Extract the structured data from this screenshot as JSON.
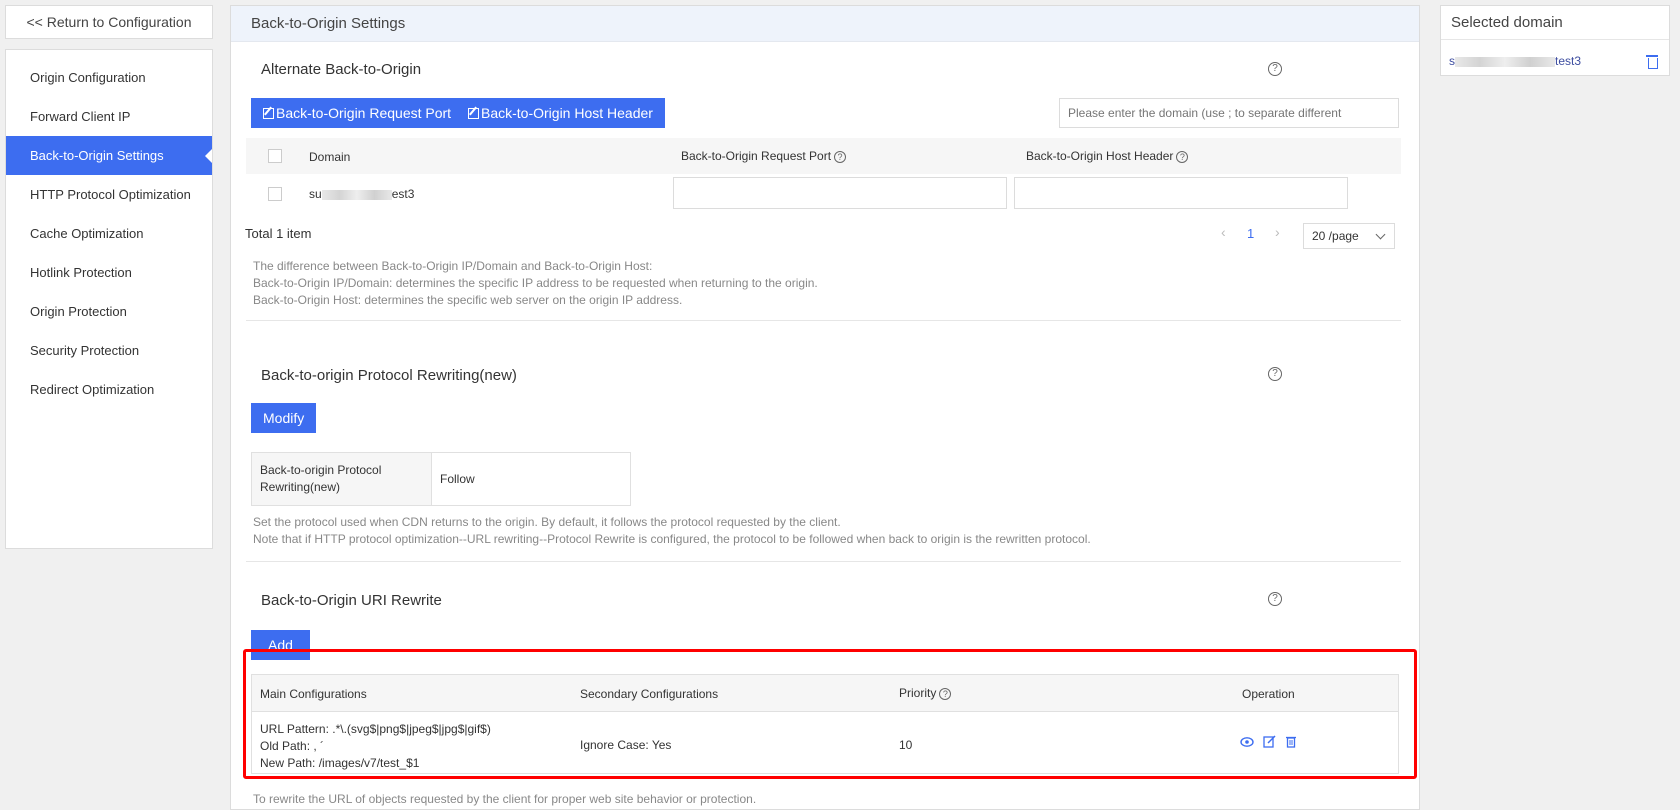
{
  "nav": {
    "back_label": "<< Return to Configuration",
    "items": [
      {
        "label": "Origin Configuration"
      },
      {
        "label": "Forward Client IP"
      },
      {
        "label": "Back-to-Origin Settings"
      },
      {
        "label": "HTTP Protocol Optimization"
      },
      {
        "label": "Cache Optimization"
      },
      {
        "label": "Hotlink Protection"
      },
      {
        "label": "Origin Protection"
      },
      {
        "label": "Security Protection"
      },
      {
        "label": "Redirect Optimization"
      }
    ],
    "active_index": 2
  },
  "header": {
    "title": "Back-to-Origin Settings"
  },
  "alternate": {
    "title": "Alternate Back-to-Origin",
    "port_button": "Back-to-Origin Request Port",
    "host_button": "Back-to-Origin Host Header",
    "search_placeholder": "Please enter the domain (use ; to separate different",
    "columns": [
      "Domain",
      "Back-to-Origin Request Port",
      "Back-to-Origin Host Header"
    ],
    "rows": [
      {
        "domain_prefix": "su",
        "domain_suffix": "est3"
      }
    ],
    "total": "Total 1 item",
    "page": "1",
    "page_size": "20 /page",
    "notes": [
      "The difference between Back-to-Origin IP/Domain and Back-to-Origin Host:",
      "Back-to-Origin IP/Domain: determines the specific IP address to be requested when returning to the origin.",
      "Back-to-Origin Host: determines the specific web server on the origin IP address."
    ]
  },
  "protocol": {
    "title": "Back-to-origin Protocol Rewriting(new)",
    "modify_button": "Modify",
    "key": "Back-to-origin Protocol Rewriting(new)",
    "value": "Follow",
    "notes": [
      "Set the protocol used when CDN returns to the origin. By default, it follows the protocol requested by the client.",
      "Note that if HTTP protocol optimization--URL rewriting--Protocol Rewrite is configured, the protocol to be followed when back to origin is the rewritten protocol."
    ]
  },
  "uri": {
    "title": "Back-to-Origin URI Rewrite",
    "add_button": "Add",
    "columns": {
      "main": "Main Configurations",
      "secondary": "Secondary Configurations",
      "priority": "Priority",
      "operation": "Operation"
    },
    "rows": [
      {
        "url_pattern": "URL Pattern: .*\\.(svg$|png$|jpeg$|jpg$|gif$)",
        "old_path": "Old Path: ,   ´",
        "new_path": "New Path: /images/v7/test_$1",
        "secondary": "Ignore Case: Yes",
        "priority": "10"
      }
    ],
    "footer_note": "To rewrite the URL of objects requested by the client for proper web site behavior or protection."
  },
  "selected": {
    "title": "Selected domain",
    "domain_prefix": "s",
    "domain_suffix": "test3"
  },
  "colors": {
    "accent": "#3d6df0",
    "highlight_border": "#ff0000",
    "header_bg": "#eef3fb"
  }
}
